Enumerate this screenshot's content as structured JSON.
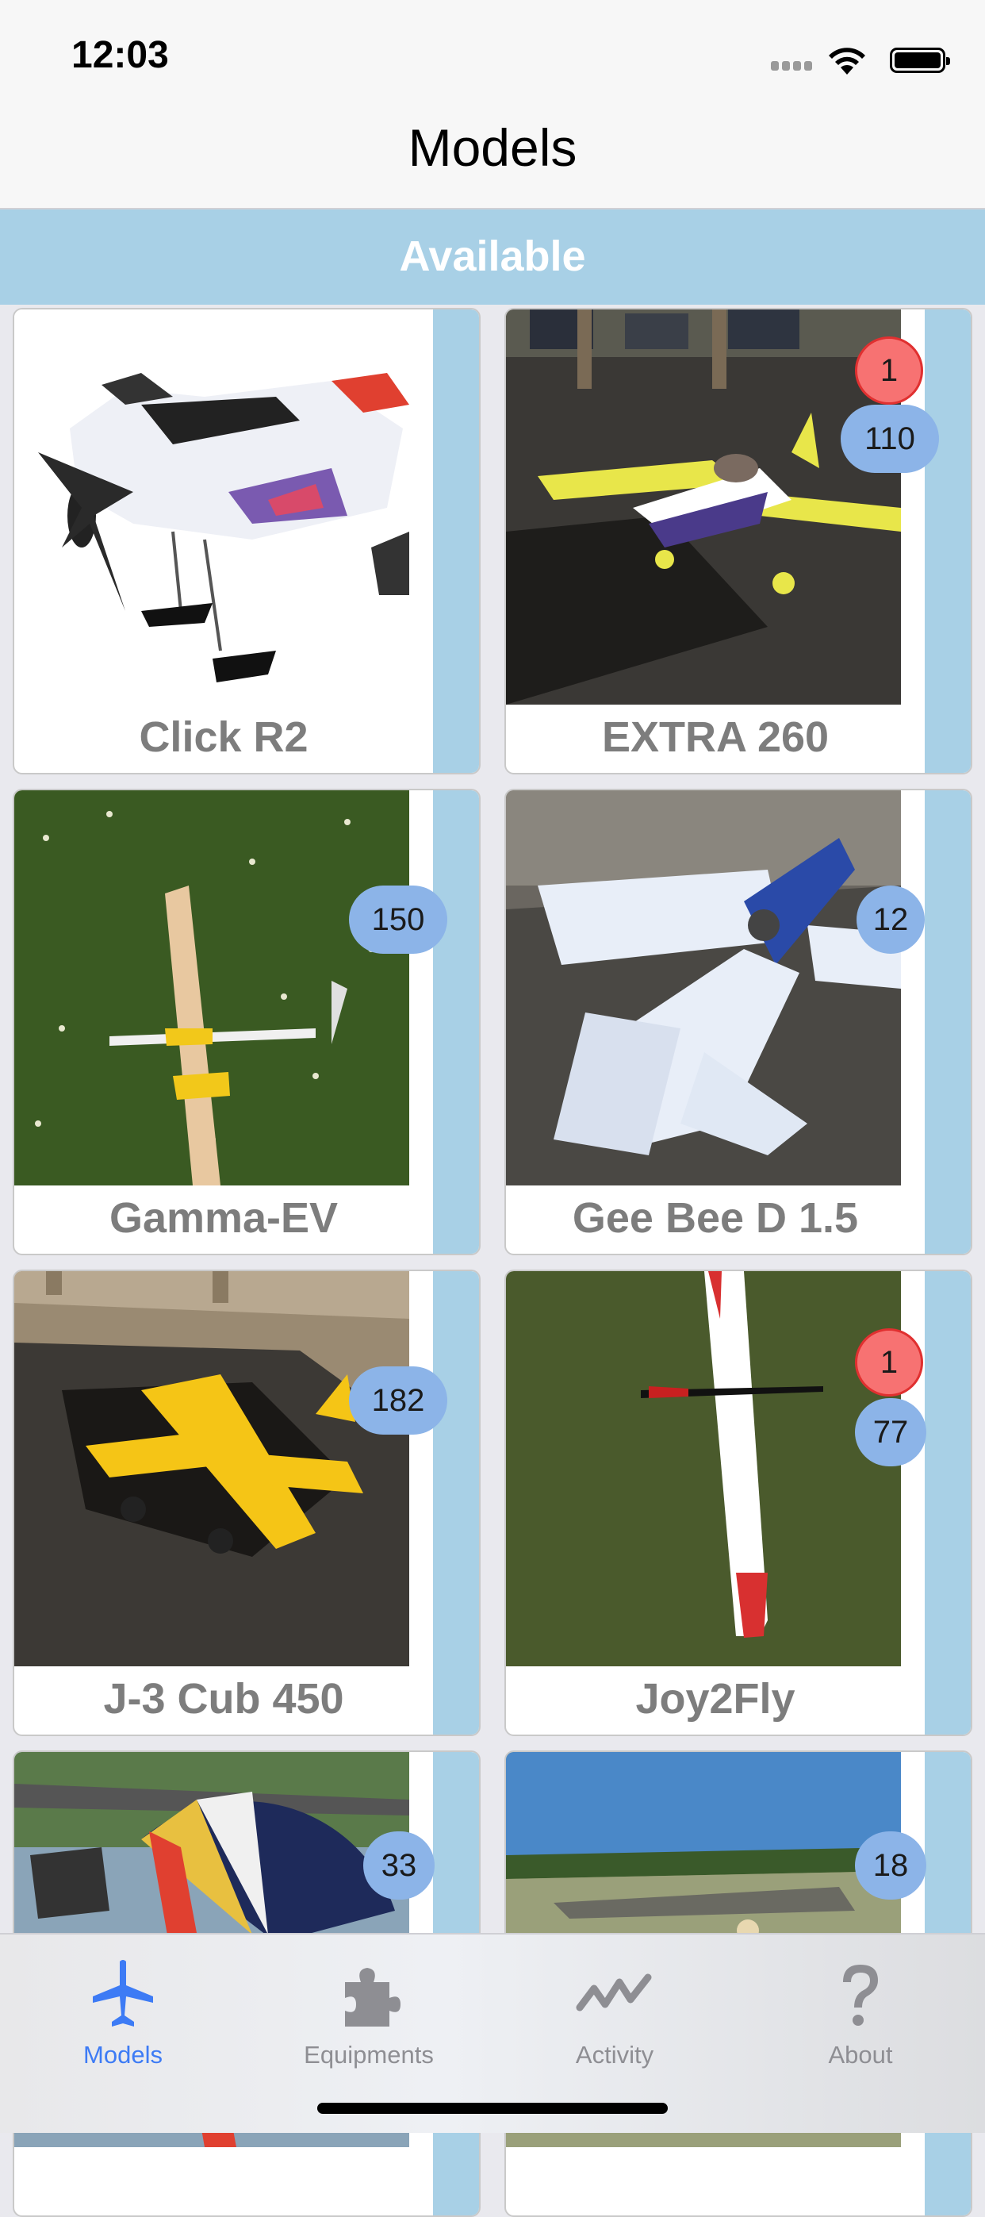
{
  "status_bar": {
    "time": "12:03"
  },
  "nav": {
    "title": "Models"
  },
  "section": {
    "title": "Available"
  },
  "models": [
    {
      "name": "Click R2",
      "count": "",
      "alert": ""
    },
    {
      "name": "EXTRA 260",
      "count": "110",
      "alert": "1"
    },
    {
      "name": "Gamma-EV",
      "count": "150",
      "alert": ""
    },
    {
      "name": "Gee Bee D 1.5",
      "count": "12",
      "alert": ""
    },
    {
      "name": "J-3 Cub 450",
      "count": "182",
      "alert": ""
    },
    {
      "name": "Joy2Fly",
      "count": "77",
      "alert": "1"
    },
    {
      "name": "",
      "count": "33",
      "alert": ""
    },
    {
      "name": "",
      "count": "18",
      "alert": ""
    }
  ],
  "tabs": [
    {
      "label": "Models",
      "icon": "airplane-icon",
      "active": true
    },
    {
      "label": "Equipments",
      "icon": "puzzle-icon",
      "active": false
    },
    {
      "label": "Activity",
      "icon": "activity-icon",
      "active": false
    },
    {
      "label": "About",
      "icon": "question-icon",
      "active": false
    }
  ],
  "colors": {
    "accent": "#3d7bf5",
    "section": "#a8d0e6",
    "count_badge": "#8cb4e8",
    "alert_badge": "#f77272"
  }
}
